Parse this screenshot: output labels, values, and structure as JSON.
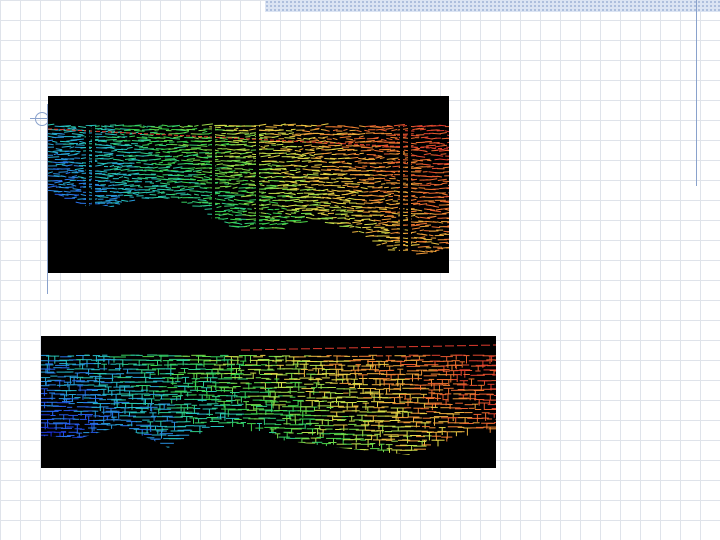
{
  "colors": {
    "background": "#ffffff",
    "grid": "#dfe3ea",
    "accent": "#8aa2cc",
    "panel_bg": "#000000",
    "ramp": [
      "#1a2bd6",
      "#2a6cf0",
      "#25c3c8",
      "#38d34a",
      "#e8e24a",
      "#f07a30",
      "#e03b2e"
    ]
  },
  "images": [
    {
      "name": "sonar-profile-top"
    },
    {
      "name": "sonar-profile-bottom"
    }
  ]
}
